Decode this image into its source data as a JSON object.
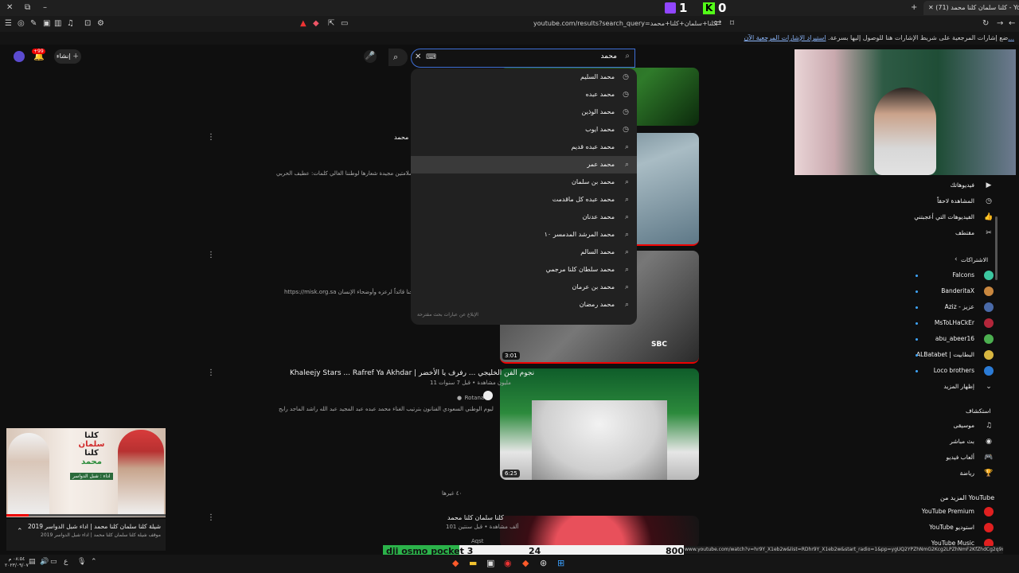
{
  "browser": {
    "tab_title": "(71) كلنا سلمان كلنا محمد - YouTube",
    "url": "youtube.com/results?search_query=كلنا+سلمان+كلنا+محمد",
    "bookmark_hint": "ضع إشارات المرجعية على شريط الإشارات هنا للوصول إليها بسرعة.",
    "bookmark_link": "استيراد الإشارات المرجعية الآن..."
  },
  "overlay": {
    "twitch_count": "1",
    "kick_count": "0"
  },
  "header": {
    "create_label": "إنشاء",
    "notif_count": "+99",
    "search_value": "محمد"
  },
  "suggestions": [
    {
      "text": "محمد السليم",
      "type": "history"
    },
    {
      "text": "محمد عبده",
      "type": "history"
    },
    {
      "text": "محمد الوذين",
      "type": "history"
    },
    {
      "text": "محمد ايوب",
      "type": "history"
    },
    {
      "text": "محمد عبده قديم",
      "type": "search"
    },
    {
      "text": "محمد عمر",
      "type": "search"
    },
    {
      "text": "محمد بن سلمان",
      "type": "search"
    },
    {
      "text": "محمد عبده كل ماقدمت",
      "type": "search"
    },
    {
      "text": "محمد عدنان",
      "type": "search"
    },
    {
      "text": "محمد المرشد المدمسر ١٠",
      "type": "search"
    },
    {
      "text": "محمد السالم",
      "type": "search"
    },
    {
      "text": "محمد سلطان كلنا مرجمي",
      "type": "search"
    },
    {
      "text": "محمد بن عرمان",
      "type": "search"
    },
    {
      "text": "محمد رمضان",
      "type": "search"
    }
  ],
  "report_label": "الإبلاغ عن عبارات بحث مقترحة",
  "results": {
    "v1_title": "كلنا سلمان كلنا محمد",
    "v1_desc": "وطن المسؤول أحوام مجيدة وسلامتين مجيدة شعارها لوطننا الغالي كلمات: عطيف الحربي",
    "v2_desc": "https://misk.org.sa وعطاء محمد لوطن بمناهجنا قائداً لرعزه وأوضحاء الإنسان",
    "v3_duration": "3:01",
    "v4_title": "Khaleejy Stars ... Rafref Ya Akhdar | نجوم الفن الخليجي ... رفرف يا الأخضر",
    "v4_meta": "11 مليون مشاهدة • قبل 7 سنوات",
    "v4_channel": "Rotana",
    "v4_desc": "كلمات: خالد الحربي - الحان سهم من مهرجان اليوم الوطني السعودي الفنانون بترتيب الغناء محمد عبده عبد المجيد عبد الله راشد الماجد رابح",
    "v4_duration": "6:25",
    "more_label": "٤٠ غيرها",
    "v5_title": "كلنا سلمان كلنا محمد",
    "v5_meta": "101 ألف مشاهدة • قبل سنتين",
    "v5_channel": "Aqst"
  },
  "miniplayer": {
    "title": "شيلة كلنا سلمان كلنا محمد | اداء شبل الدواسر 2019",
    "sub": "موقف شيلة كلنا سلمان كلنا محمد | اداء شبل الدواسر 2019",
    "thumb_line1": "كلنا",
    "thumb_line2": "سلمان",
    "thumb_line3": "كلنا",
    "thumb_line4": "محمد",
    "thumb_credit": "اداء : شبل الدواسر"
  },
  "sidebar": {
    "top_items": [
      {
        "label": "فيديوهاتك",
        "icon": "▶"
      },
      {
        "label": "المشاهدة لاحقاً",
        "icon": "◷"
      },
      {
        "label": "الفيديوهات التي أعجبتني",
        "icon": "👍"
      },
      {
        "label": "مقتطف",
        "icon": "✂"
      }
    ],
    "subs_header": "الاشتراكات",
    "subs": [
      {
        "label": "Falcons",
        "color": "#3cc7a0"
      },
      {
        "label": "BanderitaX",
        "color": "#c9873f"
      },
      {
        "label": "Aziz - عزيز",
        "color": "#4a6aa8"
      },
      {
        "label": "MsToLHaCkEr",
        "color": "#b3263a"
      },
      {
        "label": "abu_abeer16",
        "color": "#4caf50"
      },
      {
        "label": "ALBatabet | البطابيت",
        "color": "#d8b640"
      },
      {
        "label": "Loco brothers",
        "color": "#2b7bd6"
      }
    ],
    "show_more": "إظهار المزيد",
    "explore_header": "استكشاف",
    "explore": [
      {
        "label": "موسيقى",
        "icon": "♫"
      },
      {
        "label": "بث مباشر",
        "icon": "◉"
      },
      {
        "label": "ألعاب فيديو",
        "icon": "🎮"
      },
      {
        "label": "رياضة",
        "icon": "🏆"
      }
    ],
    "more_from": "المزيد من YouTube",
    "more_items": [
      {
        "label": "YouTube Premium"
      },
      {
        "label": "YouTube استوديو"
      },
      {
        "label": "YouTube Music"
      }
    ]
  },
  "status_url": "www.youtube.com/watch?v=hr9Y_X1eb2w&list=RDhr9Y_X1eb2w&start_radio=1&pp=ygUQ2YPZhNmG2Kcg2LPZhNmF2KfZhdCg2q9mE2Yb",
  "dji": {
    "label": "dji osmo pocket 3",
    "num1": "24",
    "num2": "800"
  },
  "taskbar": {
    "time": "٠٨:٥٤ م",
    "date": "٢٠٢٣/٠٩/٠٧",
    "lang": "ع"
  }
}
